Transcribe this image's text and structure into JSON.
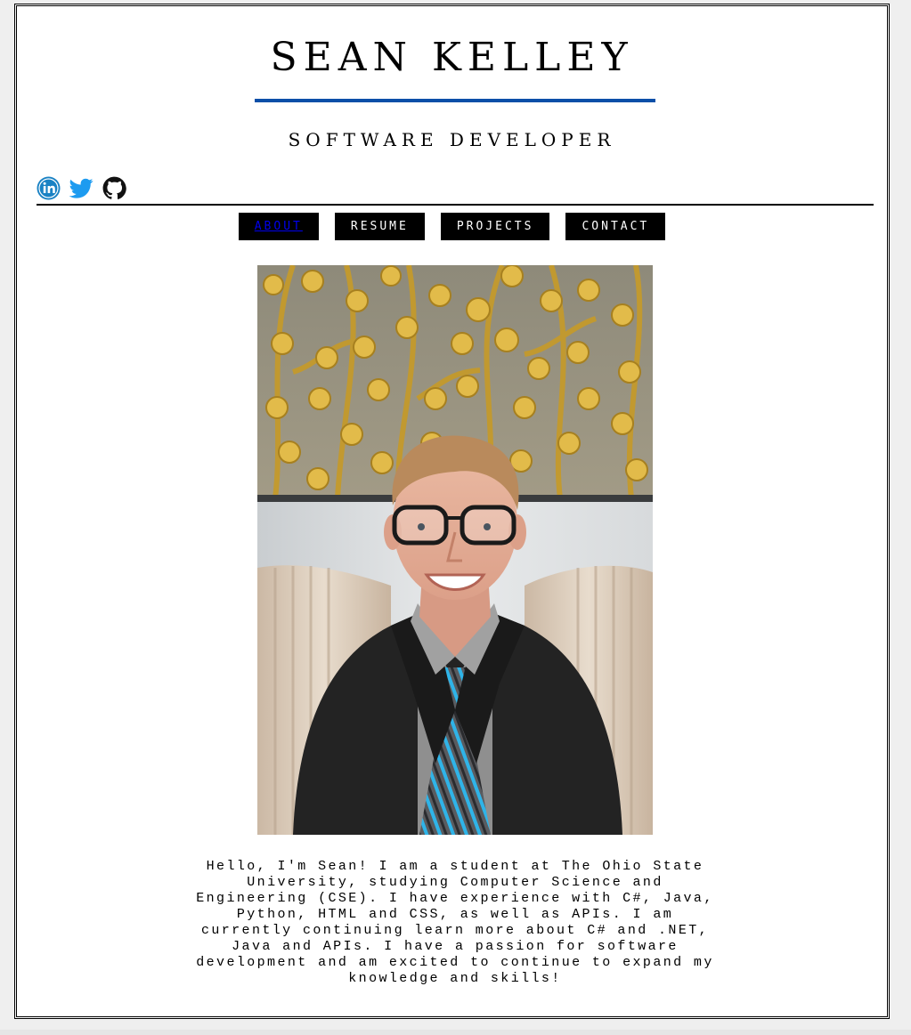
{
  "header": {
    "name": "SEAN KELLEY",
    "subtitle": "SOFTWARE DEVELOPER",
    "rule_color": "#0b4fa8"
  },
  "social": [
    {
      "icon": "linkedin-icon",
      "color": "#0e76a8"
    },
    {
      "icon": "twitter-icon",
      "color": "#1da1f2"
    },
    {
      "icon": "github-icon",
      "color": "#111111"
    }
  ],
  "nav": {
    "items": [
      {
        "label": "ABOUT",
        "active": true
      },
      {
        "label": "RESUME",
        "active": false
      },
      {
        "label": "PROJECTS",
        "active": false
      },
      {
        "label": "CONTACT",
        "active": false
      }
    ]
  },
  "main": {
    "about_text": "Hello, I'm Sean! I am a student at The Ohio State University, studying Computer Science and Engineering (CSE). I have experience with C#, Java, Python, HTML and CSS, as well as APIs. I am currently continuing learn more about C# and .NET, Java and APIs. I have a passion for software development and am excited to continue to expand my knowledge and skills!"
  }
}
